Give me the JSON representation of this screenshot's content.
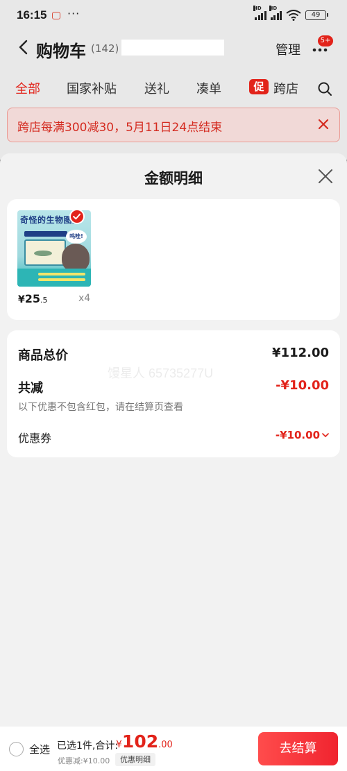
{
  "status_bar": {
    "time": "16:15",
    "dots": "···",
    "signal_label": "HD",
    "battery": "49"
  },
  "header": {
    "title": "购物车",
    "count": "(142)",
    "manage_label": "管理",
    "more_badge": "5+"
  },
  "tabs": [
    {
      "label": "全部",
      "active": true
    },
    {
      "label": "国家补贴",
      "active": false
    },
    {
      "label": "送礼",
      "active": false
    },
    {
      "label": "凑单",
      "active": false
    },
    {
      "label": "跨店",
      "active": false
    }
  ],
  "promo_tab_icon": "促",
  "promo_banner": {
    "text": "跨店每满300减30，5月11日24点结束"
  },
  "sheet": {
    "title": "金额明细",
    "product": {
      "cover_title": "奇怪的生物图鉴",
      "cover_bubble": "呜哇!",
      "price_symbol": "¥",
      "price_int": "25",
      "price_dec": ".5",
      "quantity": "x4"
    },
    "summary": {
      "goods_total_label": "商品总价",
      "goods_total_value": "¥112.00",
      "reduction_label": "共减",
      "reduction_value": "-¥10.00",
      "note": "以下优惠不包含红包，请在结算页查看",
      "coupon_label": "优惠券",
      "coupon_value": "-¥10.00",
      "watermark": "馒星人 65735277U"
    }
  },
  "bottom_bar": {
    "select_all_label": "全选",
    "selected_text": "已选1件,合计:",
    "total_symbol": "¥",
    "total_int": "102",
    "total_dec": ".00",
    "discount_text": "优惠减:¥10.00",
    "detail_label": "优惠明细",
    "checkout_label": "去结算"
  },
  "colors": {
    "accent": "#e2231a",
    "overlay": "#7e7e7e",
    "sheet_bg": "#f2f2f2"
  }
}
